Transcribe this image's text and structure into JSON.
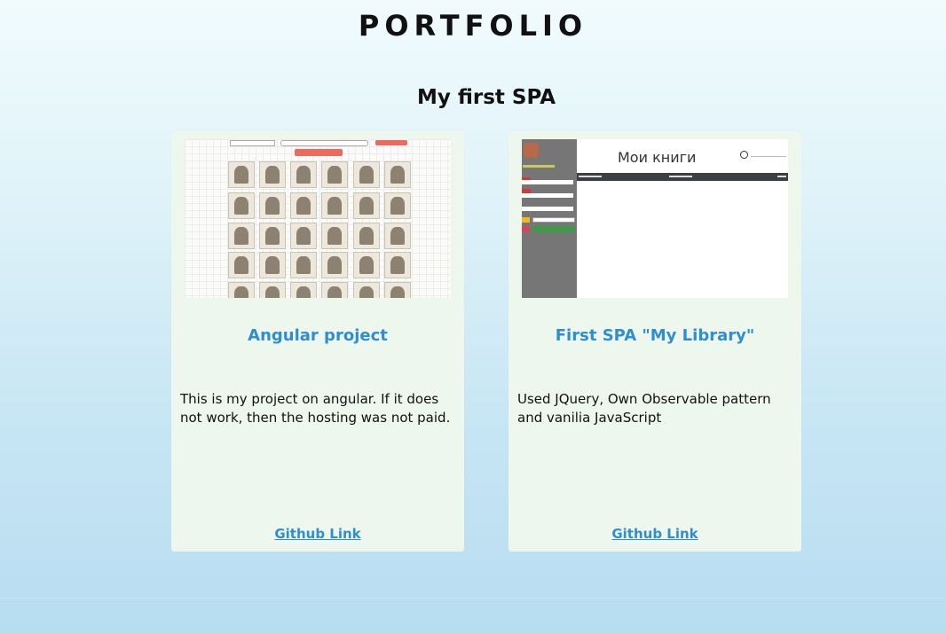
{
  "header": {
    "title": "PORTFOLIO"
  },
  "section": {
    "title": "My first SPA"
  },
  "projects": [
    {
      "title": "Angular project",
      "description": "This is my project on angular. If it does not work, then the hosting was not paid.",
      "link_label": "Github Link"
    },
    {
      "title": "First SPA \"My Library\"",
      "description": "Used JQuery, Own Observable pattern and vanilia JavaScript",
      "link_label": "Github Link",
      "thumbnail_heading": "Мои книги"
    }
  ],
  "colors": {
    "accent": "#2f8ecf",
    "card_bg": "#eef7ee"
  }
}
